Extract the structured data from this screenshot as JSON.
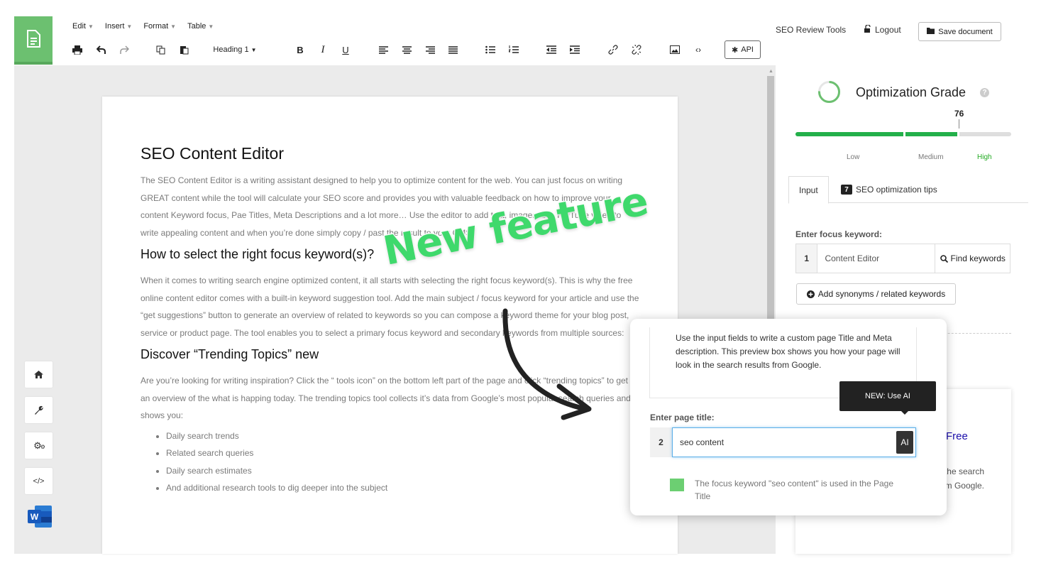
{
  "menu": {
    "items": [
      "Edit",
      "Insert",
      "Format",
      "Table"
    ]
  },
  "toolbar": {
    "heading_select": "Heading 1",
    "api_label": "API"
  },
  "header_right": {
    "seo_review_tools": "SEO Review Tools",
    "logout": "Logout",
    "save_document": "Save document"
  },
  "document": {
    "title": "SEO Content Editor",
    "intro": "The SEO Content Editor is a writing assistant designed to help you to optimize content for the web. You can just focus on writing GREAT content while the tool will calculate your SEO score and provides you with valuable feedback on how to improve your content Keyword focus, Pae Titles, Meta Descriptions and a lot more… Use the editor to add text, images and YouTube video to write appealing content and when you’re done simply copy / past the result to your CMS.",
    "h2_keywords": "How to select the right focus keyword(s)?",
    "keywords_text": "When it comes to writing search engine optimized content, it all starts with selecting the right focus keyword(s). This is why the free online content editor comes with a built-in keyword suggestion tool. Add the main subject / focus keyword for your article and use the “get suggestions” button to generate an overview of related to keywords so you can compose a keyword theme for your blog post, service or product page. The tool enables you to select a primary focus keyword and secondary keywords from multiple sources:",
    "h2_trending": "Discover “Trending Topics” new",
    "trending_text": "Are you’re looking for writing inspiration? Click the “ tools icon” on the bottom left part of the page and click “trending topics” to get an overview of the what is happing today. The trending topics tool collects it’s data from Google’s most popular search queries and shows you:",
    "bullets": [
      "Daily search trends",
      "Related search queries",
      "Daily search estimates",
      "And additional research tools to dig deeper into the subject"
    ]
  },
  "grade": {
    "title": "Optimization Grade",
    "score": "76",
    "score_fraction": 0.76,
    "labels": {
      "low": "Low",
      "medium": "Medium",
      "high": "High"
    },
    "colors": {
      "fill": "#23b04a",
      "high_label": "#22aa22"
    }
  },
  "tabs": {
    "input": "Input",
    "tips_count": "7",
    "tips_label": "SEO optimization tips"
  },
  "focus_keyword": {
    "label": "Enter focus keyword:",
    "number": "1",
    "value": "Content Editor",
    "find_button": "Find keywords",
    "add_synonyms": "Add synonyms / related keywords"
  },
  "preview_card": {
    "title_fragment": "Free",
    "text": "ustom . This ur page will look in the search results from Google."
  },
  "popup": {
    "description": "Use the input fields to write a custom page Title and Meta description. This preview box shows you how your page will look in the search results from Google.",
    "tooltip": "NEW: Use AI",
    "page_title_label": "Enter page title:",
    "page_title_number": "2",
    "page_title_value": "seo content",
    "ai_button": "AI",
    "check_text": "The focus keyword \"seo content\" is used in the Page Title"
  },
  "annotation": {
    "text": "New feature",
    "color": "#3fd96c"
  }
}
